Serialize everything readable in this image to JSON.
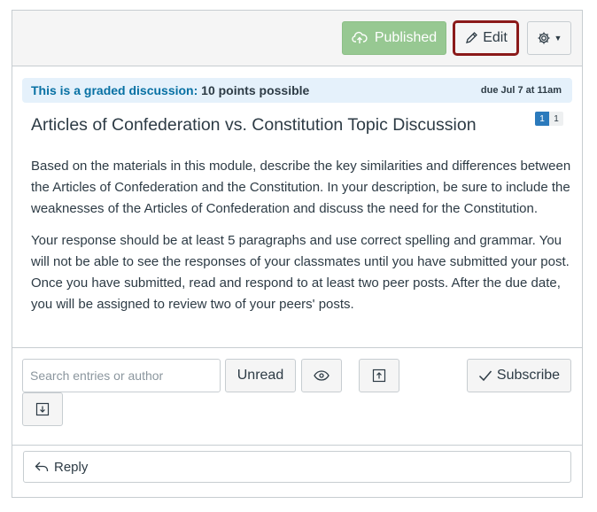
{
  "toolbar": {
    "published_label": "Published",
    "edit_label": "Edit",
    "published_color": "#97c892",
    "edit_highlight_color": "#8b1a1a"
  },
  "graded": {
    "label": "This is a graded discussion:",
    "points": "10 points possible",
    "due": "due Jul 7 at 11am"
  },
  "topic": {
    "title": "Articles of Confederation vs. Constitution Topic Discussion",
    "badge_unread": "1",
    "badge_total": "1",
    "paragraphs": [
      "Based on the materials in this module, describe the key similarities and differences between the Articles of Confederation and the Constitution. In your description, be sure to include the weaknesses of the Articles of Confederation and discuss the need for the Constitution.",
      "Your response should be at least 5 paragraphs and use correct spelling and grammar. You will not be able to see the responses of your classmates until you have submitted your post. Once you have submitted, read and respond to at least two peer posts. After the due date, you will be assigned to review two of your peers' posts."
    ]
  },
  "controls": {
    "search_placeholder": "Search entries or author",
    "unread_label": "Unread",
    "subscribe_label": "Subscribe"
  },
  "reply": {
    "label": "Reply"
  },
  "icons": {
    "published": "cloud-upload-icon",
    "edit": "pencil-icon",
    "settings": "gear-icon",
    "mark_read": "eye-icon",
    "collapse": "collapse-icon",
    "expand": "expand-icon",
    "subscribe": "checkmark-icon",
    "reply": "reply-arrow-icon"
  }
}
